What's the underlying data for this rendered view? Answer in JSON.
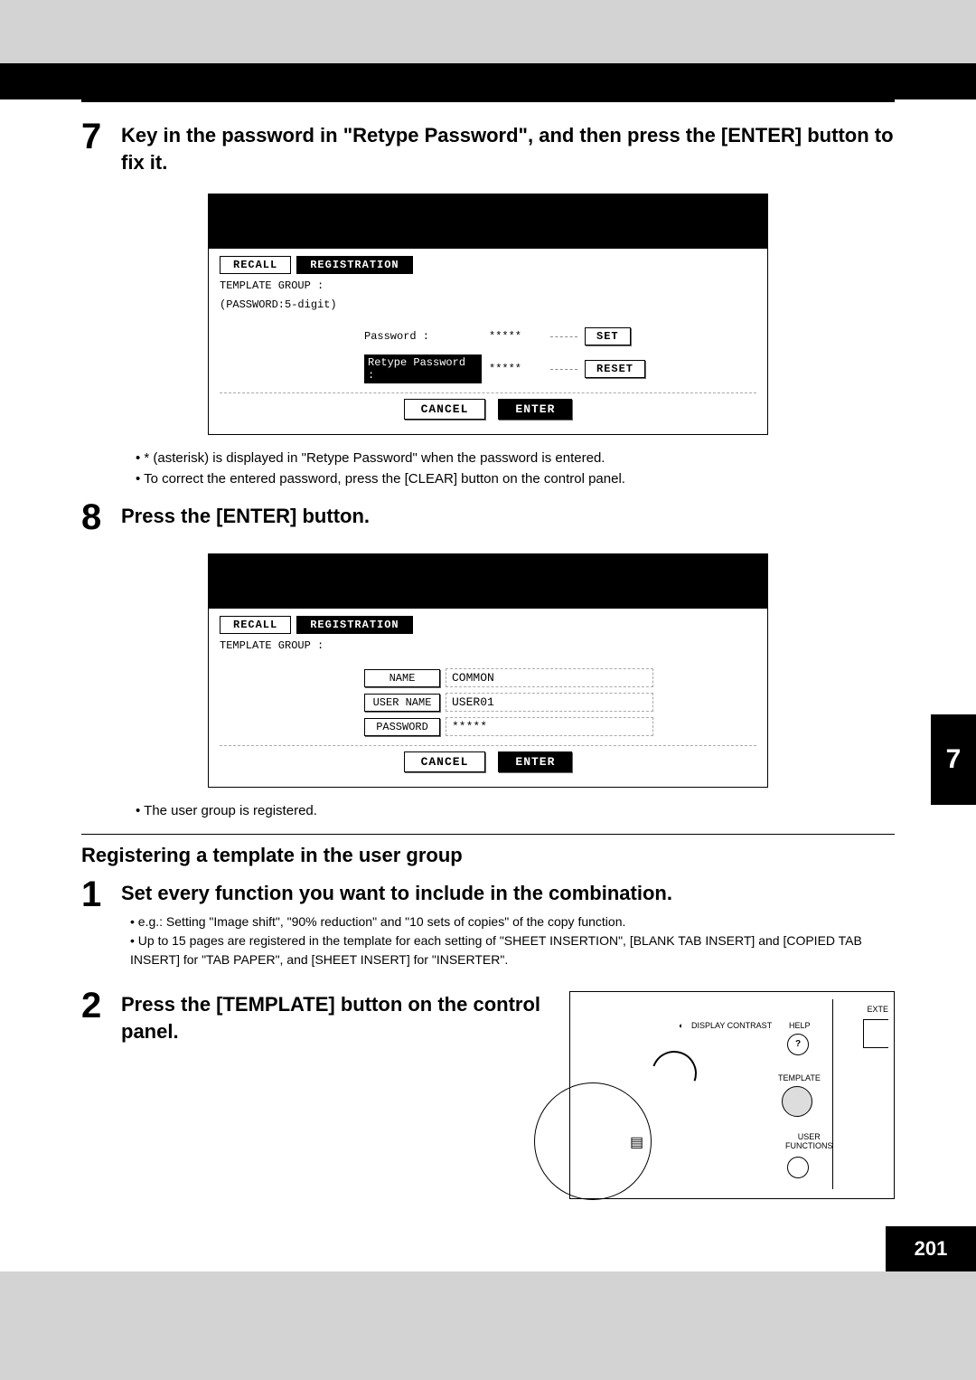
{
  "page": {
    "side_tab": "7",
    "footer": "201"
  },
  "step7": {
    "num": "7",
    "title": "Key in the password in \"Retype Password\", and then press the [ENTER] button to fix it.",
    "bullets": [
      "* (asterisk) is displayed in \"Retype Password\" when the password is entered.",
      "To correct the entered password, press the [CLEAR] button on the control panel."
    ]
  },
  "screen1": {
    "tabs": {
      "recall": "RECALL",
      "registration": "REGISTRATION"
    },
    "group_line1": "TEMPLATE GROUP    :",
    "group_line2": "(PASSWORD:5-digit)",
    "pw_label": "Password        :",
    "pw_val": "*****",
    "set": "SET",
    "retype_label": "Retype Password :",
    "retype_val": "*****",
    "reset": "RESET",
    "cancel": "CANCEL",
    "enter": "ENTER"
  },
  "step8": {
    "num": "8",
    "title": "Press the [ENTER] button.",
    "bullets": [
      "The user group is registered."
    ]
  },
  "screen2": {
    "tabs": {
      "recall": "RECALL",
      "registration": "REGISTRATION"
    },
    "group_line1": "TEMPLATE GROUP    :",
    "name_btn": "NAME",
    "name_val": "COMMON",
    "user_btn": "USER NAME",
    "user_val": "USER01",
    "pw_btn": "PASSWORD",
    "pw_val": "*****",
    "cancel": "CANCEL",
    "enter": "ENTER"
  },
  "section": {
    "title": "Registering a template in the user group"
  },
  "step1": {
    "num": "1",
    "title": "Set every function you want to include in the combination.",
    "bullets": [
      "e.g.: Setting \"Image shift\", \"90% reduction\" and \"10 sets of copies\" of the copy function.",
      "Up to 15 pages are registered in the template for each setting of \"SHEET INSERTION\", [BLANK TAB INSERT] and [COPIED TAB INSERT] for \"TAB PAPER\", and [SHEET INSERT] for \"INSERTER\"."
    ]
  },
  "step2": {
    "num": "2",
    "title": "Press the [TEMPLATE] button on the control panel."
  },
  "panel": {
    "display_contrast": "DISPLAY CONTRAST",
    "help": "HELP",
    "help_icon": "?",
    "exte": "EXTE",
    "template": "TEMPLATE",
    "user_functions": "USER\nFUNCTIONS",
    "contrast_icon": "◐"
  }
}
